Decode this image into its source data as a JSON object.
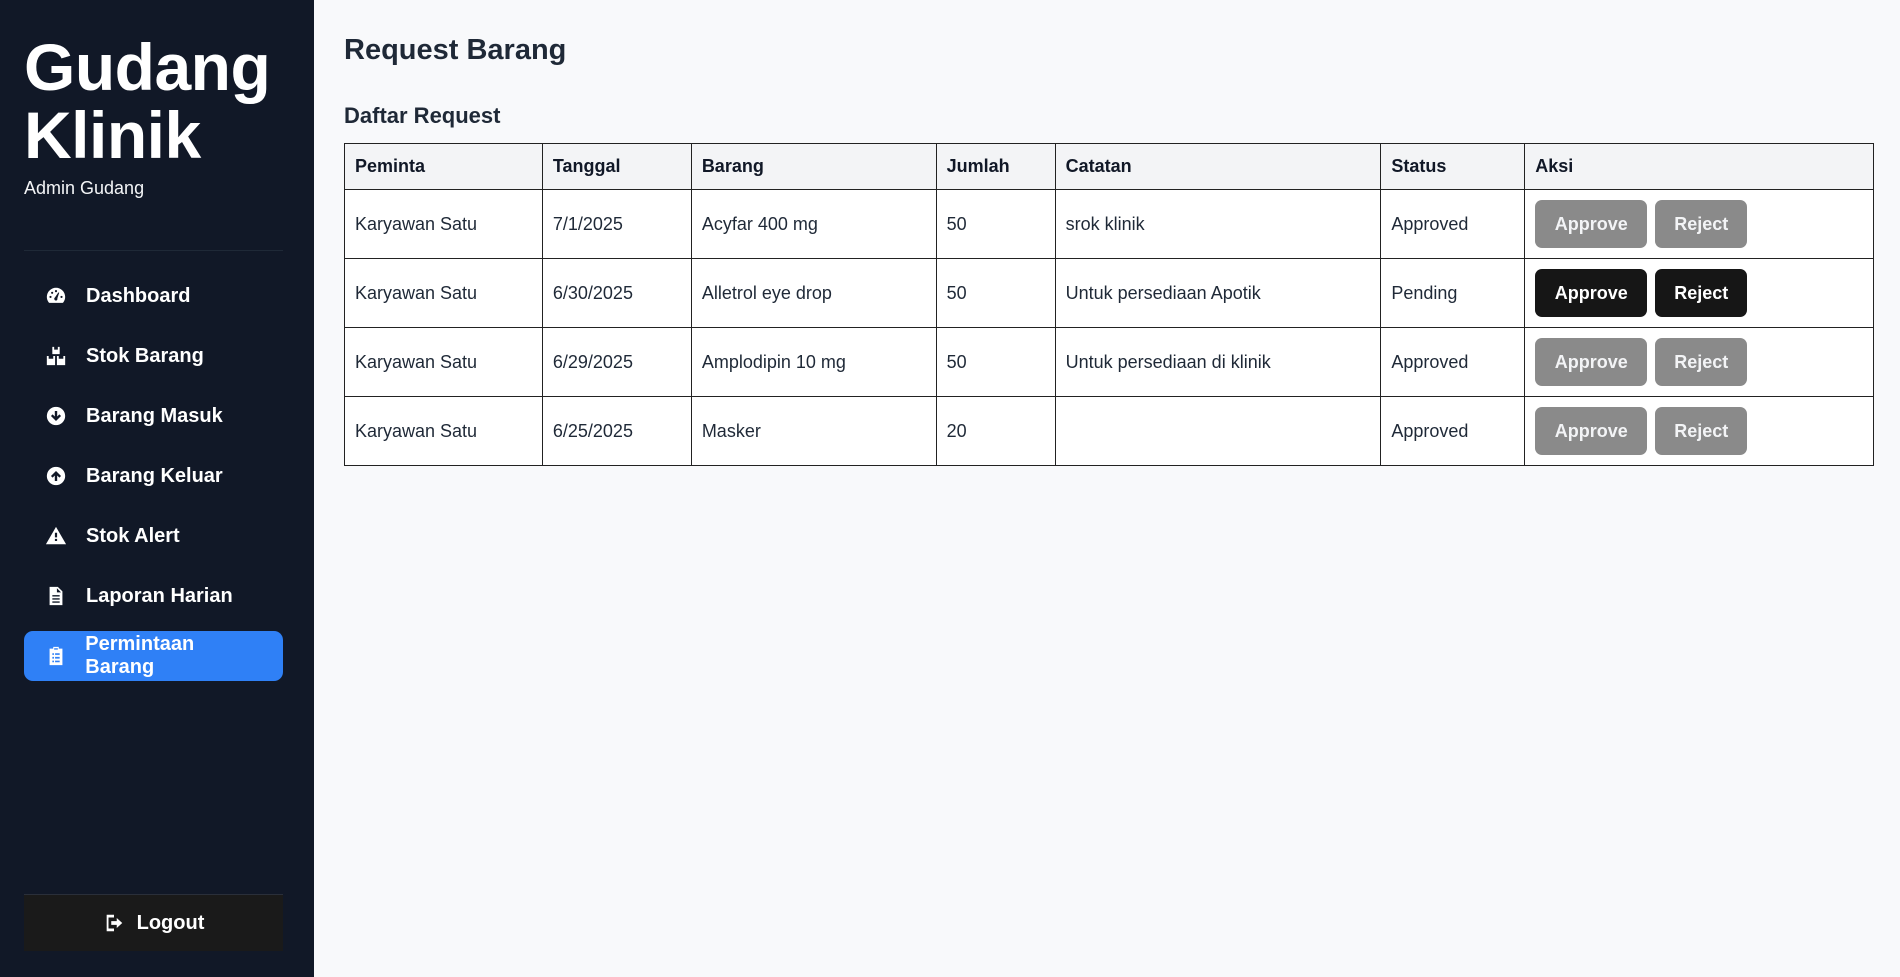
{
  "brand": {
    "title_line1": "Gudang",
    "title_line2": "Klinik",
    "subtitle": "Admin Gudang"
  },
  "sidebar": {
    "items": [
      {
        "label": "Dashboard",
        "icon": "gauge-icon"
      },
      {
        "label": "Stok Barang",
        "icon": "boxes-icon"
      },
      {
        "label": "Barang Masuk",
        "icon": "arrow-down-circle-icon"
      },
      {
        "label": "Barang Keluar",
        "icon": "arrow-up-circle-icon"
      },
      {
        "label": "Stok Alert",
        "icon": "warning-icon"
      },
      {
        "label": "Laporan Harian",
        "icon": "file-icon"
      },
      {
        "label": "Permintaan Barang",
        "icon": "clipboard-list-icon",
        "active": true
      }
    ],
    "logout_label": "Logout"
  },
  "main": {
    "page_title": "Request Barang",
    "section_title": "Daftar Request",
    "table": {
      "headers": [
        "Peminta",
        "Tanggal",
        "Barang",
        "Jumlah",
        "Catatan",
        "Status",
        "Aksi"
      ],
      "rows": [
        {
          "peminta": "Karyawan Satu",
          "tanggal": "7/1/2025",
          "barang": "Acyfar 400 mg",
          "jumlah": "50",
          "catatan": "srok klinik",
          "status": "Approved",
          "approve": "Approve",
          "reject": "Reject"
        },
        {
          "peminta": "Karyawan Satu",
          "tanggal": "6/30/2025",
          "barang": "Alletrol eye drop",
          "jumlah": "50",
          "catatan": "Untuk persediaan Apotik",
          "status": "Pending",
          "approve": "Approve",
          "reject": "Reject"
        },
        {
          "peminta": "Karyawan Satu",
          "tanggal": "6/29/2025",
          "barang": "Amplodipin 10 mg",
          "jumlah": "50",
          "catatan": "Untuk persediaan di klinik",
          "status": "Approved",
          "approve": "Approve",
          "reject": "Reject"
        },
        {
          "peminta": "Karyawan Satu",
          "tanggal": "6/25/2025",
          "barang": "Masker",
          "jumlah": "20",
          "catatan": "",
          "status": "Approved",
          "approve": "Approve",
          "reject": "Reject"
        }
      ]
    }
  },
  "colors": {
    "sidebar_bg": "#111827",
    "active_item": "#2f80f6",
    "btn_enabled": "#161616",
    "btn_disabled": "#8a8a8a",
    "page_bg": "#f8f9fb"
  }
}
